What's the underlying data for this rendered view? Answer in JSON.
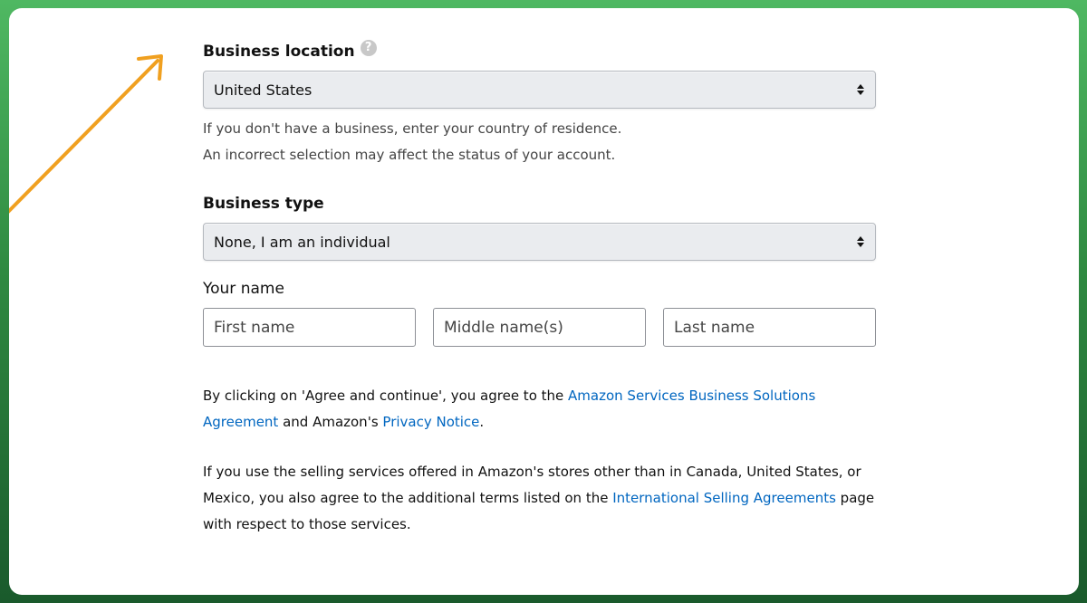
{
  "business_location": {
    "label": "Business location",
    "help_icon_glyph": "?",
    "selected_value": "United States",
    "helper_line1": "If you don't have a business, enter your country of residence.",
    "helper_line2": "An incorrect selection may affect the status of your account."
  },
  "business_type": {
    "label": "Business type",
    "selected_value": "None, I am an individual"
  },
  "your_name": {
    "label": "Your name",
    "first_placeholder": "First name",
    "middle_placeholder": "Middle name(s)",
    "last_placeholder": "Last name"
  },
  "terms1": {
    "prefix": "By clicking on 'Agree and continue', you agree to the ",
    "link1": "Amazon Services Business Solutions Agreement",
    "middle": " and Amazon's ",
    "link2": "Privacy Notice",
    "suffix": "."
  },
  "terms2": {
    "prefix": "If you use the selling services offered in Amazon's stores other than in Canada, United States, or Mexico, you also agree to the additional terms listed on the ",
    "link": "International Selling Agreements",
    "suffix": " page with respect to those services."
  },
  "colors": {
    "background_green": "#3a9a4f",
    "link_blue": "#0066c0",
    "arrow_orange": "#f0a020",
    "select_bg": "#eaecef"
  },
  "icons": {
    "help": "help-icon",
    "select_arrows": "chevron-up-down-icon",
    "pointer": "arrow-icon"
  }
}
